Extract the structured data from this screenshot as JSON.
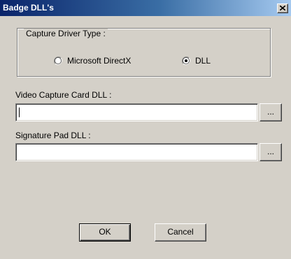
{
  "window": {
    "title": "Badge DLL's"
  },
  "capture_driver": {
    "legend": "Capture Driver Type :",
    "options": [
      {
        "label": "Microsoft DirectX",
        "selected": false
      },
      {
        "label": "DLL",
        "selected": true
      }
    ]
  },
  "video_capture": {
    "label": "Video Capture Card DLL :",
    "value": "",
    "browse_label": "..."
  },
  "signature_pad": {
    "label": "Signature Pad DLL :",
    "value": "",
    "browse_label": "..."
  },
  "buttons": {
    "ok_label": "OK",
    "cancel_label": "Cancel"
  },
  "colors": {
    "dialog_face": "#d4d0c8",
    "titlebar_start": "#0a246a",
    "titlebar_end": "#a6caf0"
  },
  "icons": {
    "close": "close-icon",
    "radio_unchecked": "radio-unchecked-icon",
    "radio_checked": "radio-checked-icon"
  }
}
